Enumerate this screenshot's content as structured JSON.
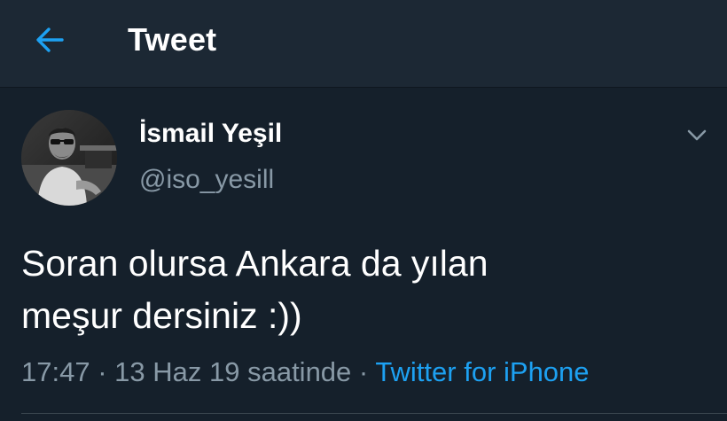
{
  "header": {
    "title": "Tweet",
    "back_icon": "arrow-left-icon",
    "accent_color": "#1da1f2"
  },
  "tweet": {
    "author": {
      "display_name": "İsmail Yeşil",
      "handle": "@iso_yesill",
      "avatar_icon": "profile-photo"
    },
    "menu_icon": "chevron-down-icon",
    "text": "Soran olursa Ankara da yılan\nmeşur dersiniz :))",
    "time": "17:47",
    "separator": "·",
    "date": "13 Haz 19 saatinde",
    "source": "Twitter for iPhone"
  },
  "colors": {
    "background": "#15202b",
    "header_background": "#1c2834",
    "secondary_text": "#8899a6",
    "link": "#1da1f2"
  }
}
